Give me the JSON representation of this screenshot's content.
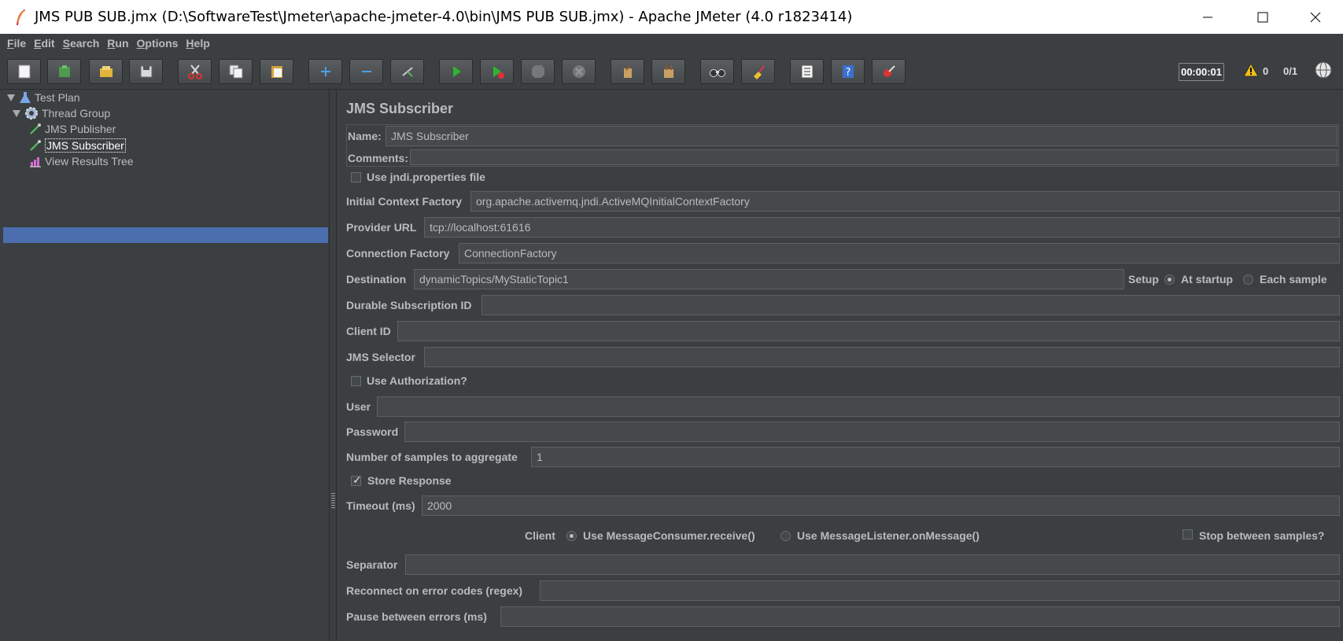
{
  "window": {
    "title": "JMS PUB SUB.jmx (D:\\SoftwareTest\\Jmeter\\apache-jmeter-4.0\\bin\\JMS PUB SUB.jmx) - Apache JMeter (4.0 r1823414)"
  },
  "menu": [
    {
      "first": "F",
      "rest": "ile"
    },
    {
      "first": "E",
      "rest": "dit"
    },
    {
      "first": "S",
      "rest": "earch"
    },
    {
      "first": "R",
      "rest": "un"
    },
    {
      "first": "O",
      "rest": "ptions"
    },
    {
      "first": "H",
      "rest": "elp"
    }
  ],
  "toolbar": {
    "timer": "00:00:01",
    "warning_count": "0",
    "threads": "0/1",
    "buttons": [
      "new-icon",
      "templates-icon",
      "open-icon",
      "save-icon",
      "cut-icon",
      "copy-icon",
      "paste-icon",
      "expand-icon",
      "collapse-icon",
      "toggle-icon",
      "start-icon",
      "start-no-pause-icon",
      "stop-icon",
      "shutdown-icon",
      "clear-icon",
      "clear-all-icon",
      "search-icon",
      "reset-search-icon",
      "function-helper-icon",
      "help-icon",
      "remote-icon"
    ]
  },
  "tree": {
    "items": [
      {
        "label": "Test Plan",
        "icon": "test-plan-icon"
      },
      {
        "label": "Thread Group",
        "icon": "gear-icon"
      },
      {
        "label": "JMS Publisher",
        "icon": "pipette-icon"
      },
      {
        "label": "JMS Subscriber",
        "icon": "pipette-icon",
        "selected": true
      },
      {
        "label": "View Results Tree",
        "icon": "chart-icon"
      }
    ]
  },
  "form": {
    "title": "JMS Subscriber",
    "name_label": "Name:",
    "name_value": "JMS Subscriber",
    "comments_label": "Comments:",
    "comments_value": "",
    "use_jndi_label": "Use jndi.properties file",
    "use_jndi_checked": false,
    "icf_label": "Initial Context Factory",
    "icf_value": "org.apache.activemq.jndi.ActiveMQInitialContextFactory",
    "provider_url_label": "Provider URL",
    "provider_url_value": "tcp://localhost:61616",
    "conn_factory_label": "Connection Factory",
    "conn_factory_value": "ConnectionFactory",
    "destination_label": "Destination",
    "destination_value": "dynamicTopics/MyStaticTopic1",
    "setup_label": "Setup",
    "at_startup_label": "At startup",
    "each_sample_label": "Each sample",
    "setup_selected": "At startup",
    "durable_label": "Durable Subscription ID",
    "durable_value": "",
    "client_id_label": "Client ID",
    "client_id_value": "",
    "selector_label": "JMS Selector",
    "selector_value": "",
    "use_auth_label": "Use Authorization?",
    "use_auth_checked": false,
    "user_label": "User",
    "user_value": "",
    "password_label": "Password",
    "password_value": "",
    "samples_label": "Number of samples to aggregate",
    "samples_value": "1",
    "store_response_label": "Store Response",
    "store_response_checked": true,
    "timeout_label": "Timeout (ms)",
    "timeout_value": "2000",
    "client_label": "Client",
    "client_receive_label": "Use MessageConsumer.receive()",
    "client_listener_label": "Use MessageListener.onMessage()",
    "client_selected": "Use MessageConsumer.receive()",
    "stop_between_label": "Stop between samples?",
    "stop_between_checked": false,
    "separator_label": "Separator",
    "separator_value": "",
    "reconnect_label": "Reconnect on error codes (regex)",
    "reconnect_value": "",
    "pause_label": "Pause between errors (ms)",
    "pause_value": ""
  }
}
